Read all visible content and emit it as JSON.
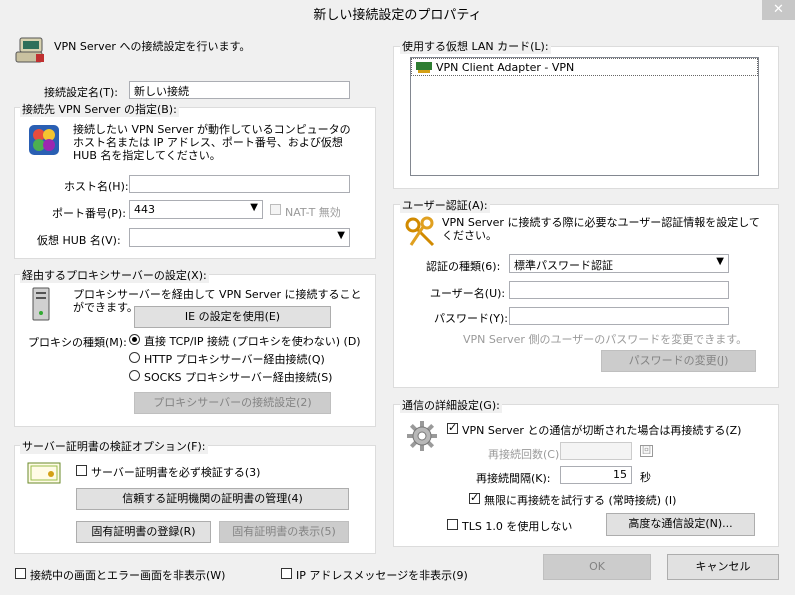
{
  "window": {
    "title": "新しい接続設定のプロパティ",
    "close_glyph": "✕"
  },
  "intro": {
    "text": "VPN Server への接続設定を行います。"
  },
  "account": {
    "label": "接続設定名(T):",
    "value": "新しい接続"
  },
  "server_group": {
    "legend": "接続先 VPN Server の指定(B):",
    "desc": "接続したい VPN Server が動作しているコンピュータのホスト名または IP アドレス、ポート番号、および仮想 HUB 名を指定してください。",
    "host_label": "ホスト名(H):",
    "host_value": "",
    "port_label": "ポート番号(P):",
    "port_value": "443",
    "nat_t_label": "NAT-T 無効",
    "hub_label": "仮想 HUB 名(V):",
    "hub_value": ""
  },
  "proxy_group": {
    "legend": "経由するプロキシサーバーの設定(X):",
    "desc": "プロキシサーバーを経由して VPN Server に接続することができます。",
    "ie_button": "IE の設定を使用(E)",
    "type_label": "プロキシの種類(M):",
    "options": [
      "直接 TCP/IP 接続 (プロキシを使わない) (D)",
      "HTTP プロキシサーバー経由接続(Q)",
      "SOCKS プロキシサーバー経由接続(S)"
    ],
    "settings_button": "プロキシサーバーの接続設定(2)"
  },
  "cert_group": {
    "legend": "サーバー証明書の検証オプション(F):",
    "verify_label": "サーバー証明書を必ず検証する(3)",
    "trusted_ca_button": "信頼する証明機関の証明書の管理(4)",
    "register_button": "固有証明書の登録(R)",
    "show_button": "固有証明書の表示(5)"
  },
  "bottom": {
    "hide_status_label": "接続中の画面とエラー画面を非表示(W)",
    "hide_ip_label": "IP アドレスメッセージを非表示(9)",
    "ok": "OK",
    "cancel": "キャンセル"
  },
  "nic_group": {
    "legend": "使用する仮想 LAN カード(L):",
    "items": [
      "VPN Client Adapter - VPN"
    ]
  },
  "auth_group": {
    "legend": "ユーザー認証(A):",
    "desc": "VPN Server に接続する際に必要なユーザー認証情報を設定してください。",
    "type_label": "認証の種類(6):",
    "type_value": "標準パスワード認証",
    "user_label": "ユーザー名(U):",
    "user_value": "",
    "password_label": "パスワード(Y):",
    "password_value": "",
    "change_note": "VPN Server 側のユーザーのパスワードを変更できます。",
    "change_button": "パスワードの変更(J)"
  },
  "adv_group": {
    "legend": "通信の詳細設定(G):",
    "reconnect_label": "VPN Server との通信が切断された場合は再接続する(Z)",
    "retry_count_label": "再接続回数(C):",
    "retry_count_unit": "回",
    "interval_label": "再接続間隔(K):",
    "interval_value": "15",
    "interval_unit": "秒",
    "infinite_label": "無限に再接続を試行する (常時接続) (I)",
    "tls_label": "TLS 1.0 を使用しない",
    "advanced_button": "高度な通信設定(N)..."
  }
}
